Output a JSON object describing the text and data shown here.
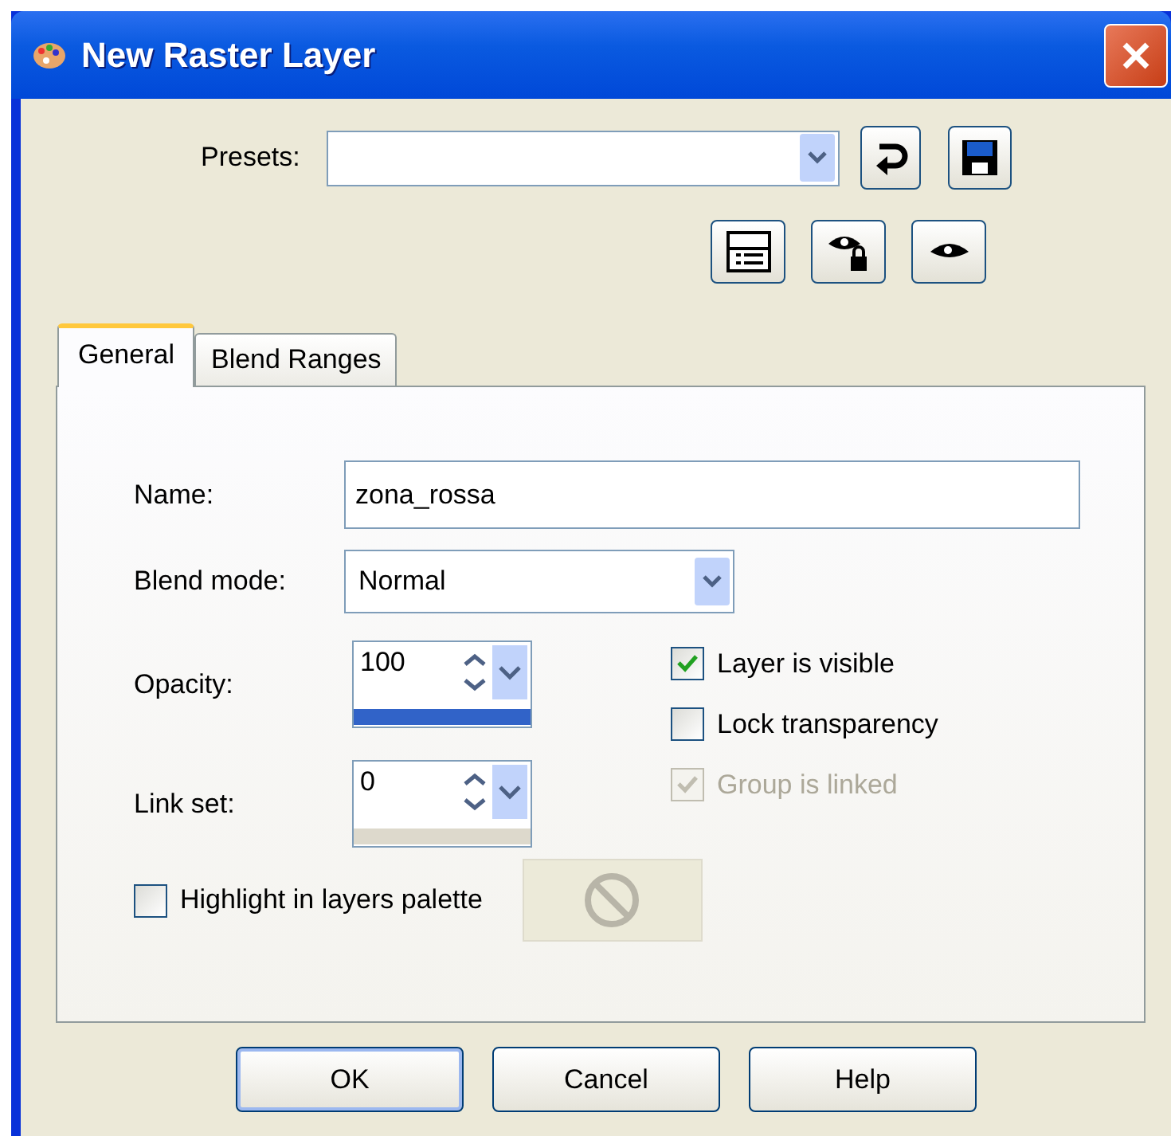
{
  "window": {
    "title": "New Raster Layer"
  },
  "presets": {
    "label": "Presets:"
  },
  "tabs": [
    {
      "label": "General",
      "selected": true
    },
    {
      "label": "Blend Ranges",
      "selected": false
    }
  ],
  "name_field": {
    "label": "Name:",
    "value": "zona_rossa"
  },
  "blend_mode": {
    "label": "Blend mode:",
    "value": "Normal"
  },
  "spinners": [
    {
      "label": "Opacity:",
      "value": "100",
      "level": 1
    },
    {
      "label": "Link set:",
      "value": "0"
    }
  ],
  "checkboxes": [
    {
      "label": "Layer is visible",
      "checked": true,
      "disabled": false
    },
    {
      "label": "Lock transparency",
      "checked": false,
      "disabled": false
    },
    {
      "label": "Group is linked",
      "checked": true,
      "disabled": true
    }
  ],
  "highlight": {
    "label": "Highlight in layers palette",
    "checked": false
  },
  "buttons": [
    {
      "label": "OK",
      "default": true
    },
    {
      "label": "Cancel",
      "default": false
    },
    {
      "label": "Help",
      "default": false
    }
  ]
}
